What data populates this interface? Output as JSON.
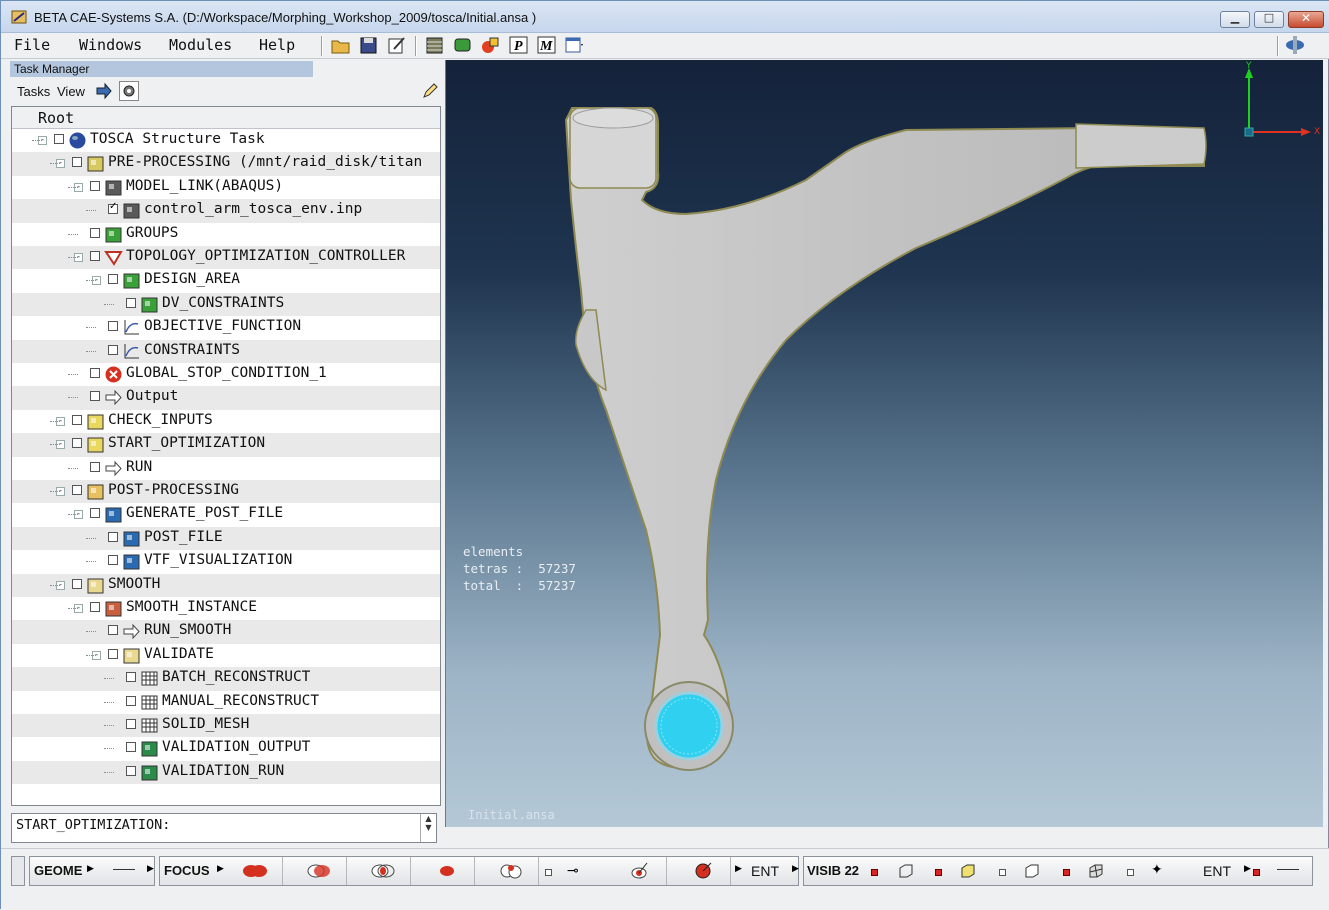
{
  "window": {
    "title": "BETA CAE-Systems S.A. (D:/Workspace/Morphing_Workshop_2009/tosca/Initial.ansa )",
    "minimize_glyph": "▁",
    "maximize_glyph": "□",
    "close_glyph": "✕"
  },
  "menu": {
    "file": "File",
    "windows": "Windows",
    "modules": "Modules",
    "help": "Help"
  },
  "task_manager": {
    "header": "Task Manager",
    "tasks_label": "Tasks",
    "view_label": "View",
    "root_label": "Root",
    "command_text": "START_OPTIMIZATION:"
  },
  "tree": [
    {
      "label": "TOSCA Structure Task",
      "icon": "globe-icon",
      "checked": false
    },
    {
      "label": "PRE-PROCESSING (/mnt/raid_disk/titan",
      "icon": "preprocessing-icon",
      "checked": false
    },
    {
      "label": "MODEL_LINK(ABAQUS)",
      "icon": "model-link-icon",
      "checked": false
    },
    {
      "label": "control_arm_tosca_env.inp",
      "icon": "mesh-file-icon",
      "checked": true
    },
    {
      "label": "GROUPS",
      "icon": "groups-icon",
      "checked": false
    },
    {
      "label": "TOPOLOGY_OPTIMIZATION_CONTROLLER",
      "icon": "topology-controller-icon",
      "checked": false
    },
    {
      "label": "DESIGN_AREA",
      "icon": "design-area-icon",
      "checked": false
    },
    {
      "label": "DV_CONSTRAINTS",
      "icon": "dv-constraints-icon",
      "checked": false
    },
    {
      "label": "OBJECTIVE_FUNCTION",
      "icon": "objective-function-icon",
      "checked": false
    },
    {
      "label": "CONSTRAINTS",
      "icon": "constraints-graph-icon",
      "checked": false
    },
    {
      "label": "GLOBAL_STOP_CONDITION_1",
      "icon": "stop-condition-icon",
      "checked": false
    },
    {
      "label": "Output",
      "icon": "output-icon",
      "checked": false
    },
    {
      "label": "CHECK_INPUTS",
      "icon": "check-inputs-icon",
      "checked": false
    },
    {
      "label": "START_OPTIMIZATION",
      "icon": "start-optimization-icon",
      "checked": false
    },
    {
      "label": "RUN",
      "icon": "run-arrow-icon",
      "checked": false
    },
    {
      "label": "POST-PROCESSING",
      "icon": "postprocessing-icon",
      "checked": false
    },
    {
      "label": "GENERATE_POST_FILE",
      "icon": "generate-post-file-icon",
      "checked": false
    },
    {
      "label": "POST_FILE",
      "icon": "post-file-icon",
      "checked": false
    },
    {
      "label": "VTF_VISUALIZATION",
      "icon": "vtf-visualization-icon",
      "checked": false
    },
    {
      "label": "SMOOTH",
      "icon": "smooth-icon",
      "checked": false
    },
    {
      "label": "SMOOTH_INSTANCE",
      "icon": "smooth-instance-icon",
      "checked": false
    },
    {
      "label": "RUN_SMOOTH",
      "icon": "run-smooth-icon",
      "checked": false
    },
    {
      "label": "VALIDATE",
      "icon": "validate-icon",
      "checked": false
    },
    {
      "label": "BATCH_RECONSTRUCT",
      "icon": "grid-icon",
      "checked": false
    },
    {
      "label": "MANUAL_RECONSTRUCT",
      "icon": "grid-icon",
      "checked": false
    },
    {
      "label": "SOLID_MESH",
      "icon": "grid-icon",
      "checked": false
    },
    {
      "label": "VALIDATION_OUTPUT",
      "icon": "validation-output-icon",
      "checked": false
    },
    {
      "label": "VALIDATION_RUN",
      "icon": "validation-run-icon",
      "checked": false
    }
  ],
  "viewport": {
    "elements_label": "elements",
    "tetras_line": "tetras :  57237",
    "total_line": "total  :  57237",
    "model_name": "Initial.ansa",
    "axis_y": "Y",
    "axis_x": "X"
  },
  "bottom_toolbar": {
    "geometry": "GEOME",
    "focus": "FOCUS",
    "ent1": "ENT",
    "visib": "VISIB 22",
    "ent2": "ENT"
  },
  "colors": {
    "viewport_top": "#14223a",
    "viewport_bottom": "#b4c8d6",
    "part_fill": "#c6c6c6",
    "highlight_cyan": "#2fd0f0"
  }
}
